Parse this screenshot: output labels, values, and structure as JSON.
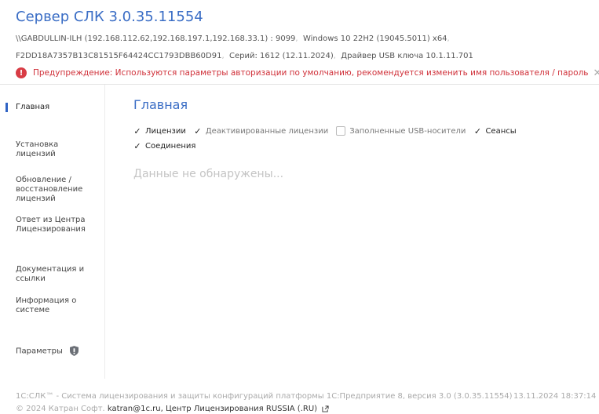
{
  "header": {
    "title": "Сервер СЛК 3.0.35.11554",
    "line1": {
      "host": "\\\\GABDULLIN-ILH (192.168.112.62,192.168.197.1,192.168.33.1) : 9099",
      "os": "Windows 10 22H2 (19045.5011) x64"
    },
    "line2": {
      "id": "F2DD18A7357B13C81515F64424CC1793DBB60D91",
      "serial": "Серий: 1612 (12.11.2024)",
      "driver": "Драйвер USB ключа 10.1.11.701"
    },
    "warning": "Предупреждение: Используются параметры авторизации по умолчанию, рекомендуется изменить имя пользователя / пароль"
  },
  "sidebar": {
    "items": [
      {
        "label": "Главная"
      },
      {
        "label": "Установка лицензий"
      },
      {
        "label": "Обновление / восстановление лицензий"
      },
      {
        "label": "Ответ из Центра Лицензирования"
      },
      {
        "label": "Документация и ссылки"
      },
      {
        "label": "Информация о системе"
      },
      {
        "label": "Параметры"
      }
    ]
  },
  "main": {
    "title": "Главная",
    "filters": [
      {
        "label": "Лицензии",
        "checked": true
      },
      {
        "label": "Деактивированные лицензии",
        "checked": true
      },
      {
        "label": "Заполненные USB-носители",
        "checked": false
      },
      {
        "label": "Сеансы",
        "checked": true
      },
      {
        "label": "Соединения",
        "checked": true
      }
    ],
    "empty_text": "Данные не обнаружены..."
  },
  "footer": {
    "line1": "1С:СЛК™ - Система лицензирования и защиты конфигураций платформы 1С:Предприятие 8, версия 3.0 (3.0.35.11554)",
    "timestamp": "13.11.2024 18:37:14",
    "copyright": "© 2024 Катран Софт.",
    "email": "katran@1c.ru",
    "center": "Центр Лицензирования RUSSIA (.RU)"
  },
  "colors": {
    "accent": "#3a6dc5",
    "warning": "#d0313a",
    "active_marker": "#2f63c4"
  }
}
